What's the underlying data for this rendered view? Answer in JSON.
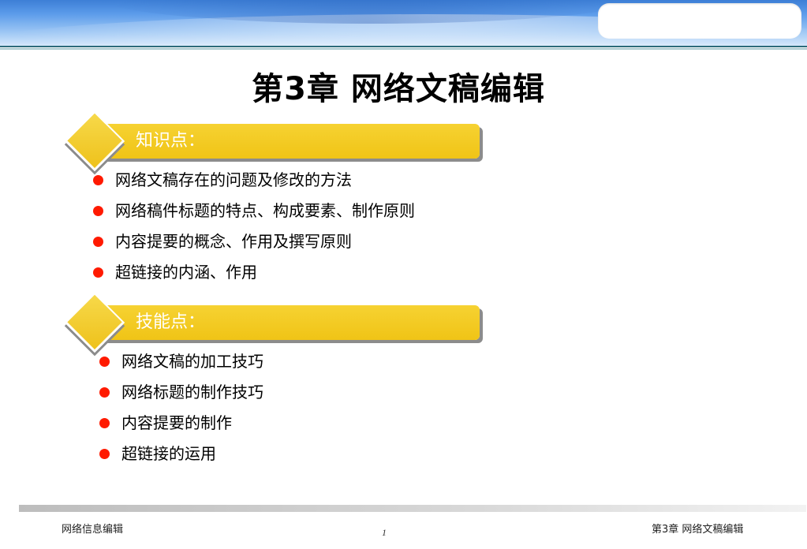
{
  "slide": {
    "title": "第3章  网络文稿编辑",
    "sections": [
      {
        "label": "知识点：",
        "items": [
          "网络文稿存在的问题及修改的方法",
          "网络稿件标题的特点、构成要素、制作原则",
          "内容提要的概念、作用及撰写原则",
          "超链接的内涵、作用"
        ]
      },
      {
        "label": "技能点：",
        "items": [
          "网络文稿的加工技巧",
          "网络标题的制作技巧",
          "内容提要的制作",
          "超链接的运用"
        ]
      }
    ]
  },
  "footer": {
    "left": "网络信息编辑",
    "page": "1",
    "right": "第3章 网络文稿编辑"
  },
  "colors": {
    "bar_yellow": "#f0c416",
    "bullet_red": "#ff1a00",
    "header_blue": "#3d7fd6"
  }
}
